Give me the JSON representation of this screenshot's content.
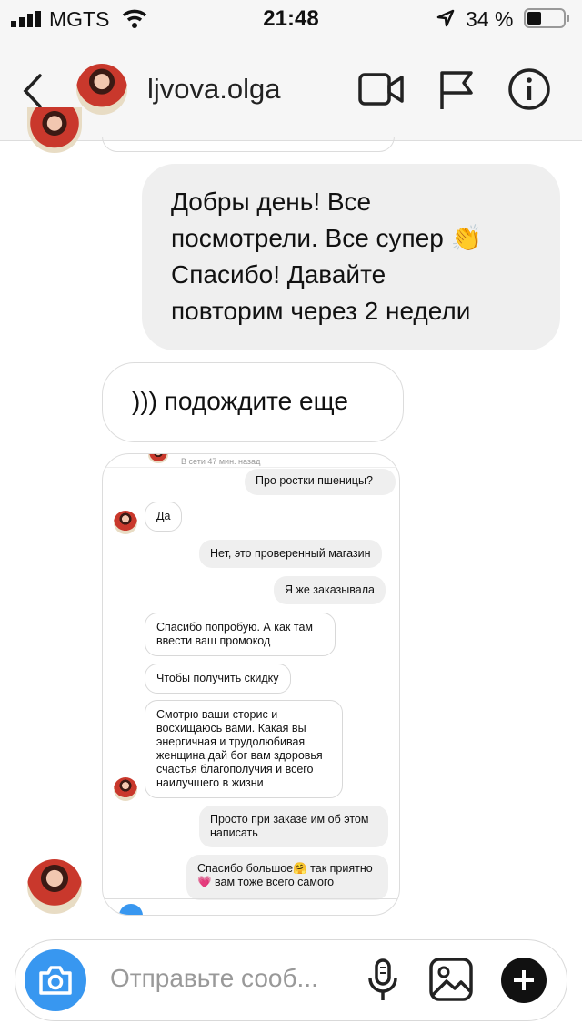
{
  "status_bar": {
    "carrier": "MGTS",
    "time": "21:48",
    "battery_pct": "34 %"
  },
  "header": {
    "username": "ljvova.olga"
  },
  "messages": [
    {
      "dir": "out",
      "lines": [
        "Добры день! Все",
        "посмотрели. Все супер 👏",
        "Спасибо! Давайте",
        "повторим через 2 недели"
      ]
    },
    {
      "dir": "in",
      "text": "))) подождите еще"
    }
  ],
  "screenshot": {
    "status": "В сети 47 мин. назад",
    "messages": [
      {
        "dir": "out",
        "text": "Про ростки пшеницы?"
      },
      {
        "dir": "in",
        "text": "Да"
      },
      {
        "dir": "out",
        "text": "Нет, это проверенный магазин"
      },
      {
        "dir": "out",
        "text": "Я же заказывала"
      },
      {
        "dir": "in",
        "lines": [
          "Спасибо попробую.  А как там",
          "ввести ваш промокод"
        ]
      },
      {
        "dir": "in",
        "text": "Чтобы получить скидку"
      },
      {
        "dir": "in",
        "lines": [
          "Смотрю ваши сторис и",
          "восхищаюсь вами. Какая вы",
          "энергичная и трудолюбивая",
          "женщина дай бог вам здоровья",
          "счастья благополучия и всего",
          "наилучшего в жизни"
        ]
      },
      {
        "dir": "out",
        "lines": [
          "Просто при заказе им об этом",
          "написать"
        ]
      },
      {
        "dir": "out",
        "lines": [
          "Спасибо большое🤗 так приятно",
          "💗 вам тоже всего самого"
        ]
      }
    ]
  },
  "composer": {
    "placeholder": "Отправьте сооб..."
  },
  "colors": {
    "accent": "#3897f0",
    "bubble_out": "#efefef",
    "bar_bg": "#f6f6f6"
  }
}
